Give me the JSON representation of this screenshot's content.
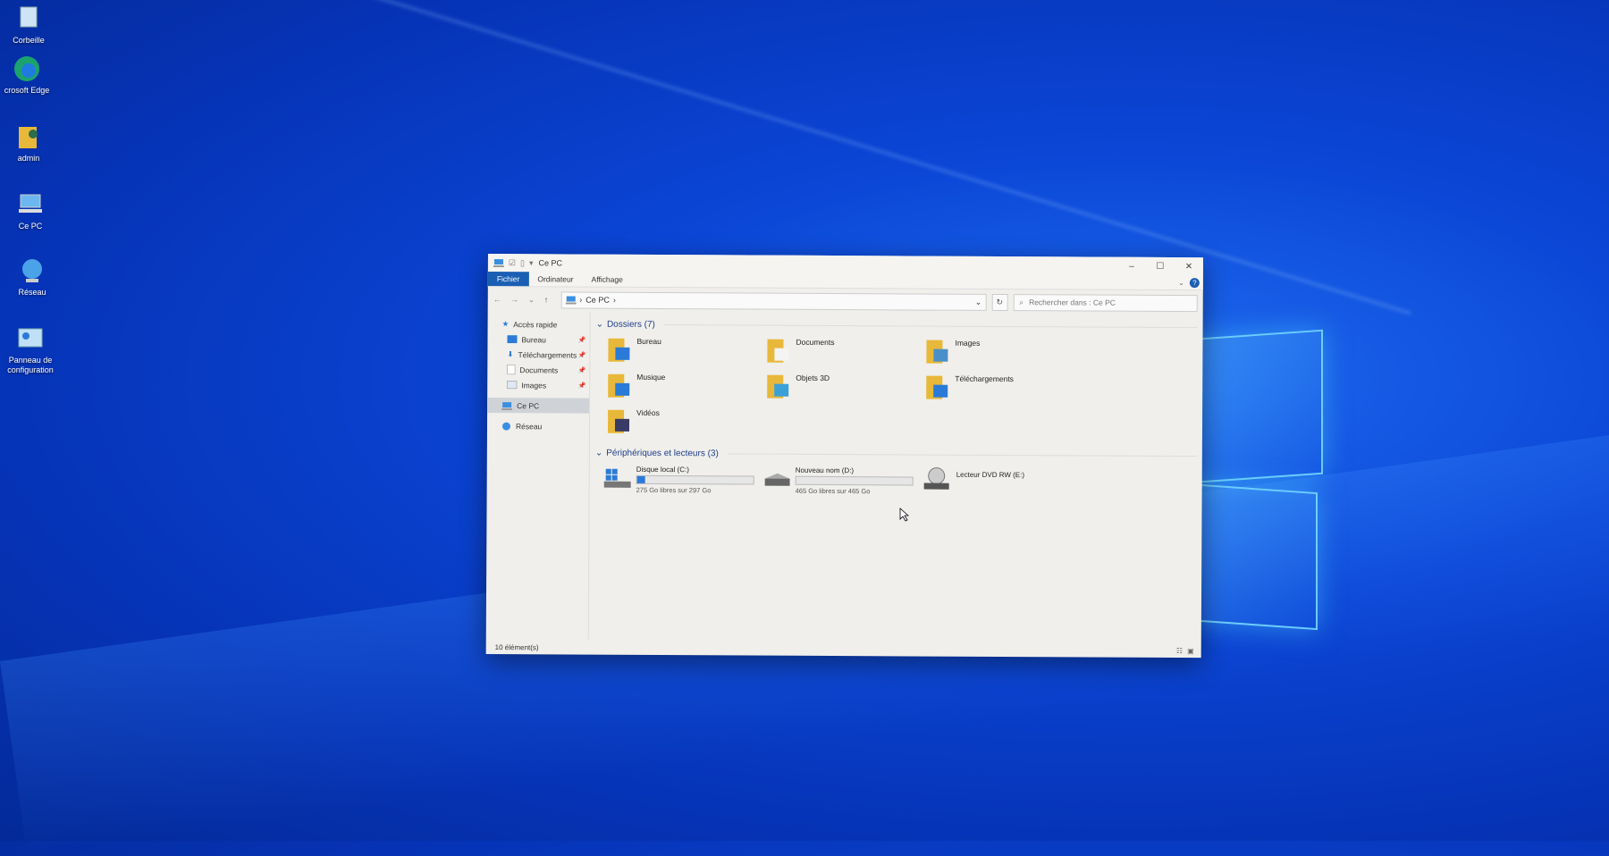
{
  "desktop": {
    "icons": [
      {
        "label": "Corbeille",
        "icon": "recycle-bin-icon"
      },
      {
        "label": "crosoft Edge",
        "icon": "edge-icon"
      },
      {
        "label": "admin",
        "icon": "user-folder-icon"
      },
      {
        "label": "Ce PC",
        "icon": "computer-icon"
      },
      {
        "label": "Réseau",
        "icon": "network-icon"
      },
      {
        "label": "Panneau de configuration",
        "icon": "control-panel-icon"
      }
    ]
  },
  "window": {
    "title": "Ce PC",
    "ribbon_tabs": [
      "Fichier",
      "Ordinateur",
      "Affichage"
    ],
    "active_tab": "Fichier",
    "address": {
      "location": "Ce PC"
    },
    "search": {
      "placeholder": "Rechercher dans : Ce PC"
    },
    "nav_pane": {
      "quick_access": "Accès rapide",
      "pinned": [
        "Bureau",
        "Téléchargements",
        "Documents",
        "Images"
      ],
      "this_pc": "Ce PC",
      "network": "Réseau"
    },
    "folders_header": "Dossiers (7)",
    "folders": [
      "Bureau",
      "Documents",
      "Images",
      "Musique",
      "Objets 3D",
      "Téléchargements",
      "Vidéos"
    ],
    "devices_header": "Périphériques et lecteurs (3)",
    "drives": [
      {
        "name": "Disque local (C:)",
        "free_text": "275 Go libres sur 297 Go",
        "used_fraction": 0.07
      },
      {
        "name": "Nouveau nom (D:)",
        "free_text": "465 Go libres sur 465 Go",
        "used_fraction": 0.0
      },
      {
        "name": "Lecteur DVD RW (E:)",
        "free_text": ""
      }
    ],
    "status": "10 élément(s)"
  },
  "colors": {
    "accent": "#1a5fb4",
    "folder": "#e8b83a",
    "desktop": "#0b46d6"
  }
}
